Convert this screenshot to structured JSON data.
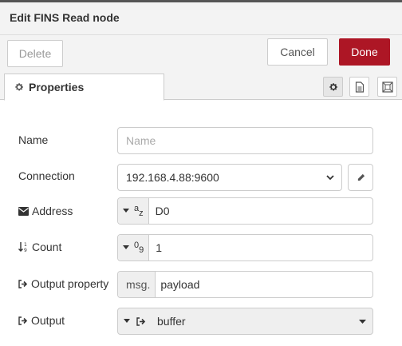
{
  "header": {
    "title": "Edit FINS Read node"
  },
  "toolbar": {
    "delete_label": "Delete",
    "cancel_label": "Cancel",
    "done_label": "Done"
  },
  "tabs": {
    "properties_label": "Properties"
  },
  "form": {
    "name": {
      "label": "Name",
      "placeholder": "Name",
      "value": ""
    },
    "connection": {
      "label": "Connection",
      "value": "192.168.4.88:9600"
    },
    "address": {
      "label": "Address",
      "type_glyph": "a",
      "type_glyph_sub": "z",
      "value": "D0"
    },
    "count": {
      "label": "Count",
      "type_glyph": "0",
      "type_glyph_sub": "9",
      "value": "1"
    },
    "output_property": {
      "label": "Output property",
      "prefix": "msg.",
      "value": "payload"
    },
    "output": {
      "label": "Output",
      "value": "buffer"
    }
  },
  "colors": {
    "done": "#ad1625",
    "header_bg": "#f3f3f3",
    "border": "#cccccc"
  },
  "icons": [
    "gear-icon",
    "doc-icon",
    "frame-icon",
    "envelope-icon",
    "sort-numeric-icon",
    "sign-out-icon",
    "pencil-icon",
    "caret-down-icon",
    "chevron-down-icon"
  ]
}
